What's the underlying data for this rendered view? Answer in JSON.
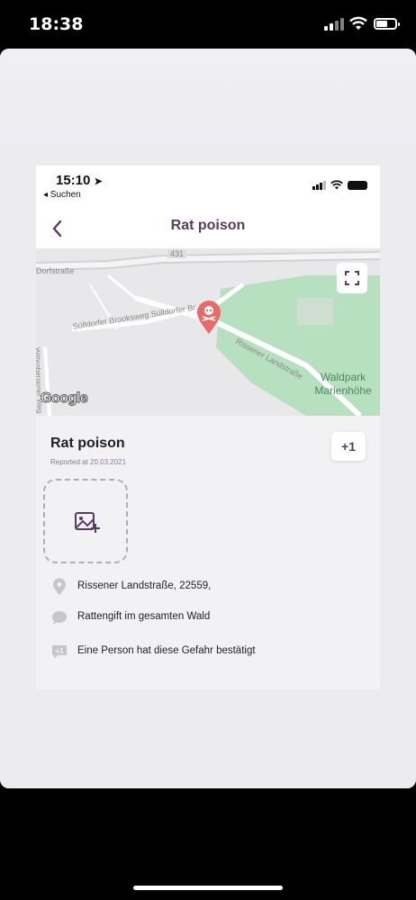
{
  "outer_status": {
    "time": "18:38"
  },
  "inner_status": {
    "time": "15:10",
    "back_app": "◂ Suchen"
  },
  "nav": {
    "title": "Rat poison"
  },
  "map": {
    "labels": {
      "dorfstrasse": "Dorfstraße",
      "road_number": "431",
      "brooksweg": "Sülldorfer Brooksweg  Sülldorfer Br...",
      "landstrasse": "Rissener Landstraße",
      "wittenberg": "Wittenbergener Weg",
      "park": "Waldpark Marienhöhe"
    },
    "google": "Google",
    "marker_icon": "skull-icon",
    "colors": {
      "marker": "#e86a6a",
      "park": "#b3dfbd",
      "road": "#ffffff"
    }
  },
  "panel": {
    "title": "Rat poison",
    "reported": "Reported at 20.03.2021",
    "confirm_label": "+1",
    "address": "Rissener Landstraße, 22559,",
    "comment": "Rattengift im gesamten Wald",
    "confirmed_text": "Eine Person hat diese Gefahr bestätigt",
    "confirm_icon_text": "+1"
  },
  "colors": {
    "accent": "#5a3a62"
  }
}
